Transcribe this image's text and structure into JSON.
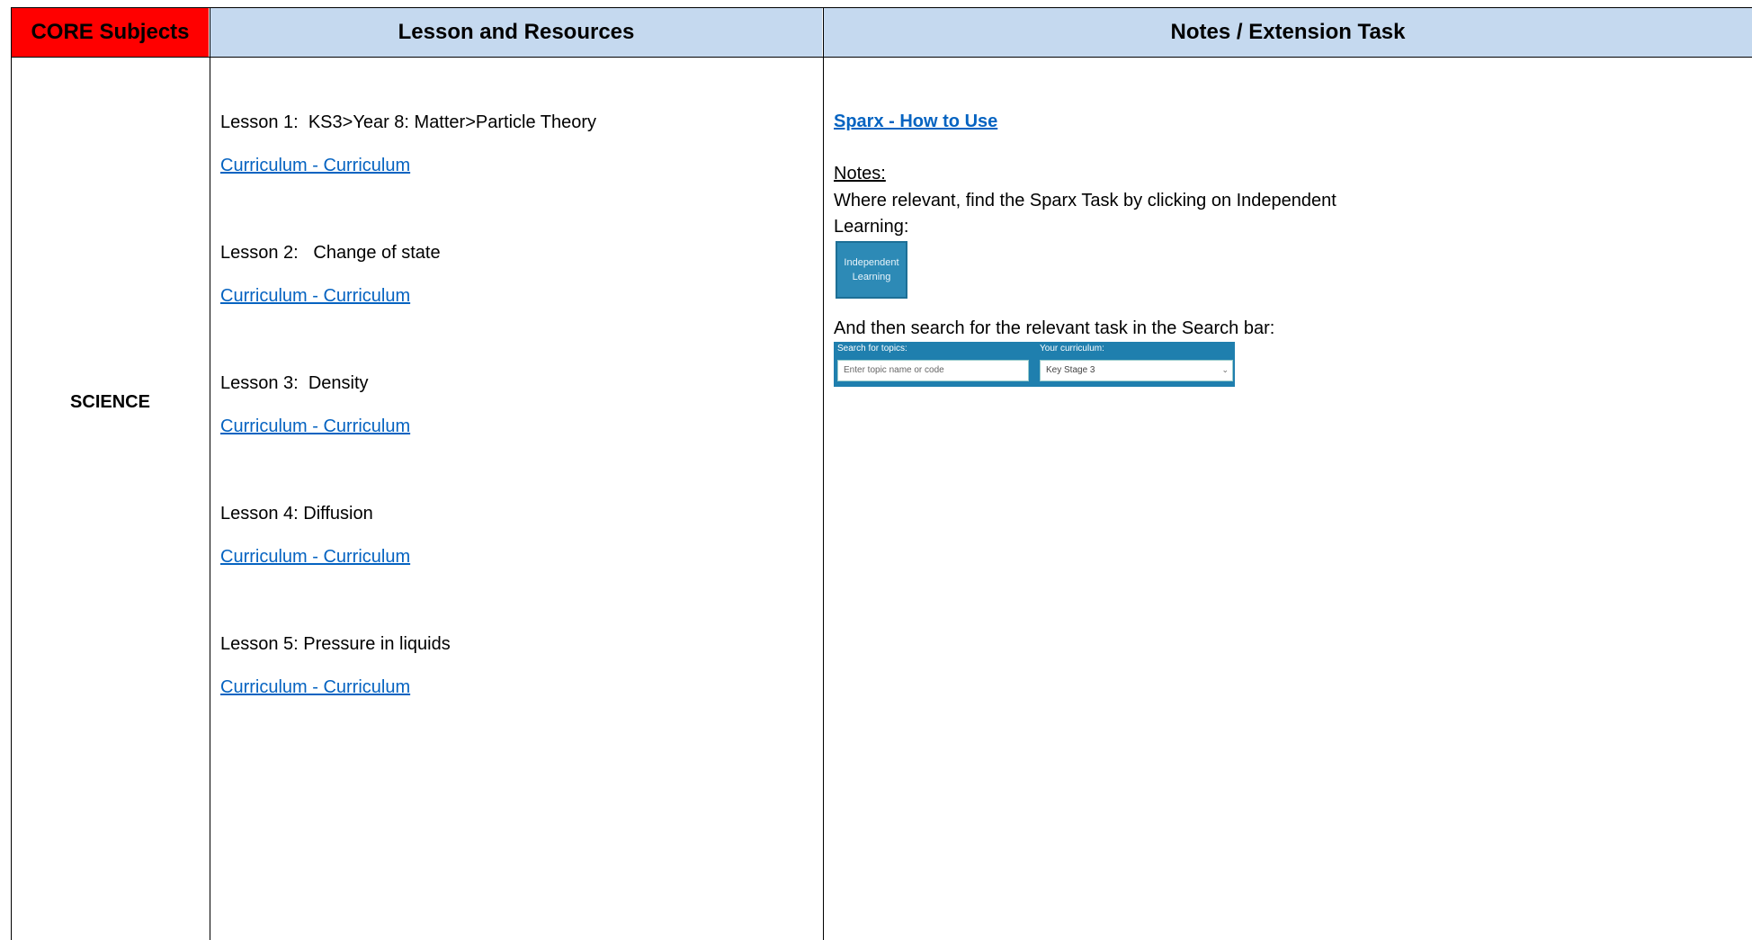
{
  "header": {
    "core": "CORE Subjects",
    "lesson": "Lesson and Resources",
    "notes": "Notes / Extension Task"
  },
  "subject": "SCIENCE",
  "lessons": [
    {
      "title": "Lesson 1:  KS3>Year 8: Matter>Particle Theory",
      "link": "Curriculum - Curriculum"
    },
    {
      "title": "Lesson 2:   Change of state",
      "link": "Curriculum - Curriculum"
    },
    {
      "title": "Lesson 3:  Density",
      "link": "Curriculum - Curriculum"
    },
    {
      "title": "Lesson 4: Diffusion",
      "link": "Curriculum - Curriculum"
    },
    {
      "title": "Lesson 5: Pressure in liquids",
      "link": "Curriculum - Curriculum"
    }
  ],
  "notes": {
    "sparx_link": "Sparx - How to Use",
    "heading": "Notes:",
    "text1": "Where relevant, find the Sparx Task by clicking on Independent Learning:",
    "independent_learning_button": "Independent Learning",
    "text2": "And then search for the relevant task in the Search bar:",
    "search": {
      "topics_label": "Search for topics:",
      "curriculum_label": "Your curriculum:",
      "input_placeholder": "Enter topic name or code",
      "curriculum_value": "Key Stage 3"
    }
  },
  "colors": {
    "core_header_bg": "#ff0000",
    "header_bg": "#c5d9ef",
    "link": "#0563c1",
    "sparx_blue": "#1f7fae"
  }
}
